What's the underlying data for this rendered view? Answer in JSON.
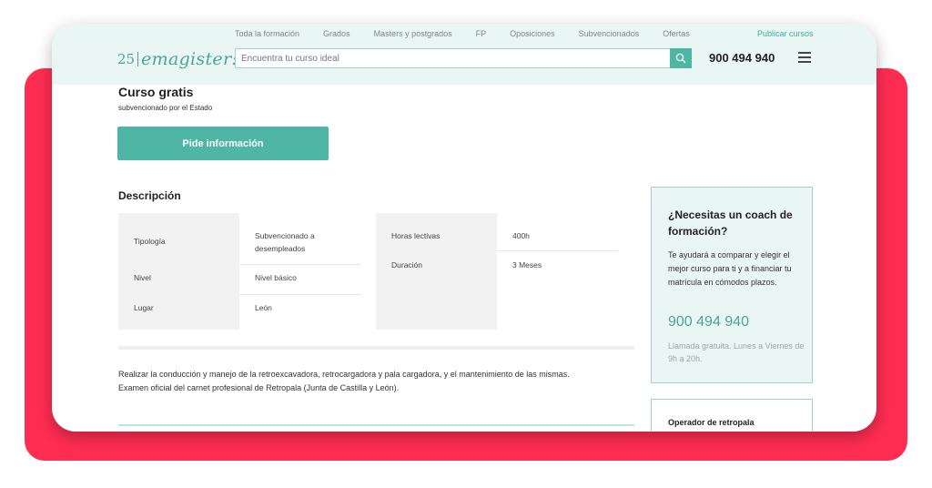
{
  "header": {
    "nav": [
      "Toda la formación",
      "Grados",
      "Masters y postgrados",
      "FP",
      "Oposiciones",
      "Subvencionados",
      "Ofertas"
    ],
    "publish_label": "Publicar cursos",
    "logo": {
      "number": "25",
      "brand": "emagister:"
    },
    "search_placeholder": "Encuentra tu curso ideal",
    "phone": "900 494 940"
  },
  "course": {
    "title": "Curso gratis",
    "subtitle": "subvencionado por el Estado",
    "cta_label": "Pide información"
  },
  "description": {
    "title": "Descripción",
    "left_table": [
      {
        "label": "Tipología",
        "value": "Subvencionado a desempleados"
      },
      {
        "label": "Nivel",
        "value": "Nivel básico"
      },
      {
        "label": "Lugar",
        "value": "León"
      }
    ],
    "right_table": [
      {
        "label": "Horas lectivas",
        "value": "400h"
      },
      {
        "label": "Duración",
        "value": "3 Meses"
      }
    ],
    "paragraph_1": "Realizar la conducción y manejo de la retroexcavadora, retrocargadora y pala cargadora, y el mantenimiento de las mismas.",
    "paragraph_2": "Examen oficial del carnet profesional de Retropala (Junta de Castilla y León)."
  },
  "sidebar": {
    "coach_title": "¿Necesitas un coach de formación?",
    "coach_text": "Te ayudará a comparar y elegir el mejor curso para ti y a financiar tu matrícula en cómodos plazos.",
    "coach_phone": "900 494 940",
    "coach_note": "Llamada gratuita. Lunes a Viernes de 9h a 20h.",
    "card_title": "Operador de retropala"
  },
  "colors": {
    "accent": "#4fb5a5",
    "frame": "#ff2d52",
    "header_bg": "#eaf6f3"
  },
  "icons": {
    "search": "search-icon",
    "menu": "hamburger-menu-icon"
  }
}
